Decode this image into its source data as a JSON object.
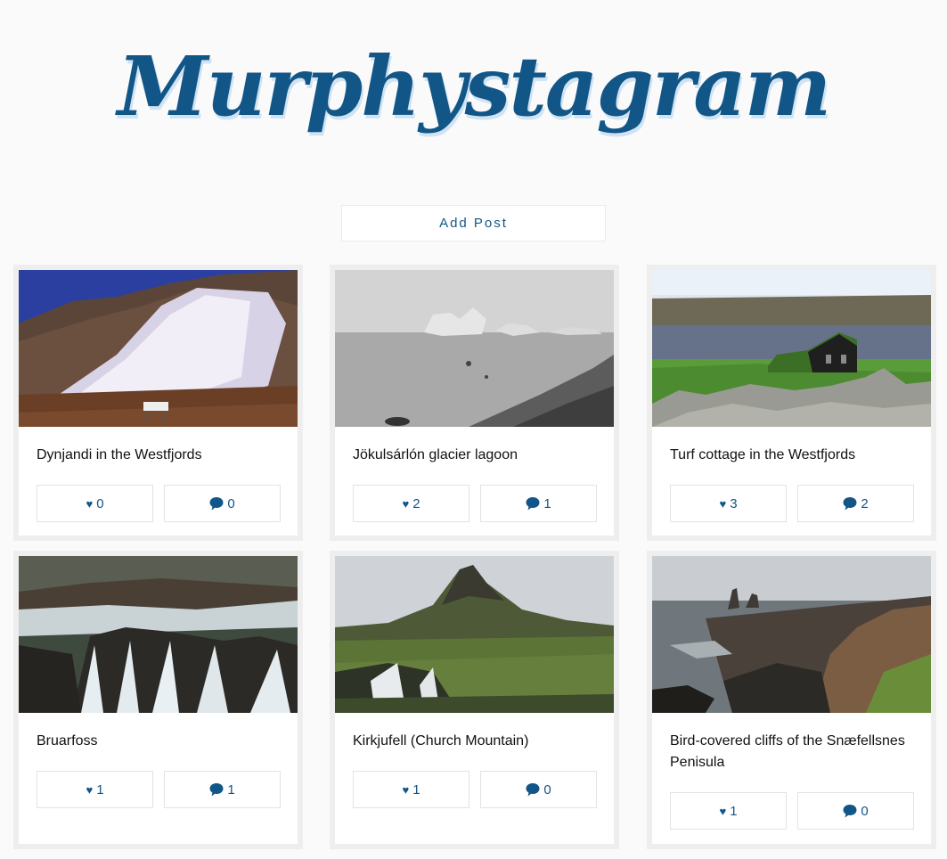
{
  "app": {
    "title": "Murphystagram"
  },
  "toolbar": {
    "add_post_label": "Add Post"
  },
  "icons": {
    "like": "heart-icon",
    "comment": "comment-bubble-icon"
  },
  "colors": {
    "brand": "#125688",
    "background": "#fafafa",
    "card_border": "#eeeeee"
  },
  "posts": [
    {
      "caption": "Dynjandi in the Westfjords",
      "likes": "0",
      "comments": "0"
    },
    {
      "caption": "Jökulsárlón glacier lagoon",
      "likes": "2",
      "comments": "1"
    },
    {
      "caption": "Turf cottage in the Westfjords",
      "likes": "3",
      "comments": "2"
    },
    {
      "caption": "Bruarfoss",
      "likes": "1",
      "comments": "1"
    },
    {
      "caption": "Kirkjufell (Church Mountain)",
      "likes": "1",
      "comments": "0"
    },
    {
      "caption": "Bird-covered cliffs of the Snæfellsnes Penisula",
      "likes": "1",
      "comments": "0"
    }
  ]
}
